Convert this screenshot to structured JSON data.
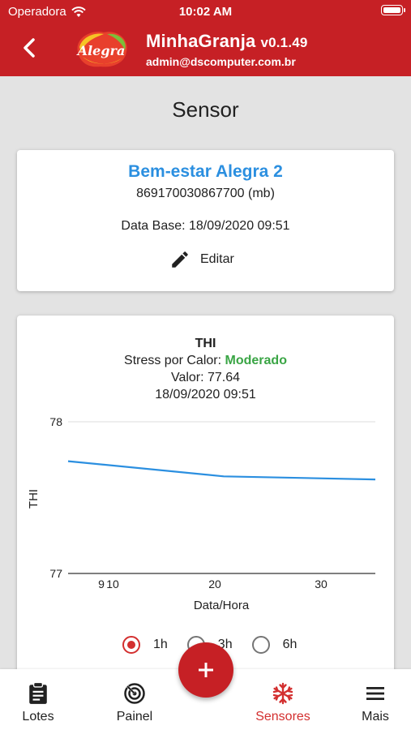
{
  "status_bar": {
    "carrier": "Operadora",
    "time": "10:02 AM"
  },
  "header": {
    "logo_text": "Alegra",
    "app_name": "MinhaGranja",
    "version": "v0.1.49",
    "email": "admin@dscomputer.com.br"
  },
  "page": {
    "title": "Sensor"
  },
  "sensor_card": {
    "name": "Bem-estar Alegra 2",
    "id": "869170030867700 (mb)",
    "data_base": "Data Base: 18/09/2020 09:51",
    "edit_label": "Editar"
  },
  "chart_card": {
    "title": "THI",
    "stress_label": "Stress por Calor:",
    "stress_value": "Moderado",
    "value_text": "Valor: 77.64",
    "date_text": "18/09/2020 09:51",
    "radio_options": [
      {
        "label": "1h",
        "selected": true
      },
      {
        "label": "3h",
        "selected": false
      },
      {
        "label": "6h",
        "selected": false
      }
    ]
  },
  "chart_data": {
    "type": "line",
    "xlabel": "Data/Hora",
    "ylabel": "THI",
    "ylim": [
      77,
      78
    ],
    "yticks": [
      77,
      78
    ],
    "xticks": [
      "9",
      "10",
      "20",
      "30"
    ],
    "series": [
      {
        "values": [
          77.74,
          77.64,
          77.62
        ]
      }
    ],
    "line_color": "#2b8fe0",
    "grid": true
  },
  "bottom_nav": {
    "items": [
      {
        "label": "Lotes",
        "icon": "clipboard-icon"
      },
      {
        "label": "Painel",
        "icon": "radar-icon"
      },
      {
        "label": "Sensores",
        "icon": "snowflake-icon",
        "active": true
      },
      {
        "label": "Mais",
        "icon": "menu-icon"
      }
    ],
    "fab_icon": "plus-icon"
  },
  "colors": {
    "primary": "#c62025",
    "accent_blue": "#2b8fe0",
    "status_green": "#3aa545"
  }
}
